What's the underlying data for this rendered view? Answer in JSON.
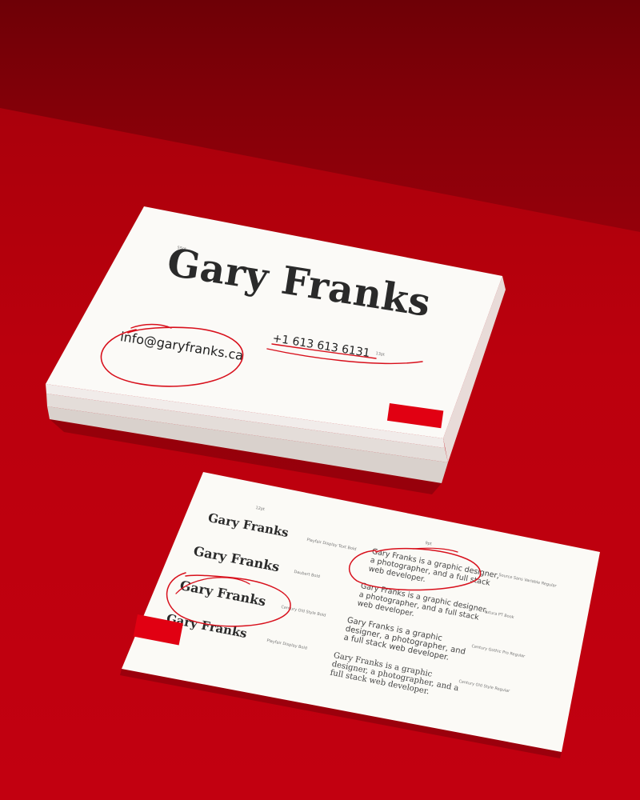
{
  "card_front": {
    "name": "Gary Franks",
    "email": "info@garyfranks.ca",
    "phone": "+1 613 613 6131",
    "annotation_name": "55pt",
    "annotation_phone": "13pt"
  },
  "card_specimen": {
    "title_annotation": "12pt",
    "para_annotation": "9pt",
    "name_samples": [
      {
        "text": "Gary Franks",
        "label": "Playfair Display Text Bold"
      },
      {
        "text": "Gary Franks",
        "label": "Daubert Bold"
      },
      {
        "text": "Gary Franks",
        "label": "Century Old Style Bold"
      },
      {
        "text": "Gary Franks",
        "label": "Playfair Display Bold"
      }
    ],
    "paragraph_samples": [
      {
        "lines": [
          "Gary Franks is a graphic designer,",
          "a photographer, and a full stack",
          "web developer."
        ],
        "label": "Source Sans Variable Regular"
      },
      {
        "lines": [
          "Gary Franks is a graphic designer,",
          "a photographer, and a full stack",
          "web developer."
        ],
        "label": "Futura PT Book"
      },
      {
        "lines": [
          "Gary Franks is a graphic",
          "designer, a photographer, and",
          "a full stack web developer."
        ],
        "label": "Century Gothic Pro Regular"
      },
      {
        "lines": [
          "Gary Franks is a graphic",
          "designer, a photographer, and a",
          "full stack web developer."
        ],
        "label": "Century Old Style Regular"
      }
    ]
  },
  "colors": {
    "accent_red": "#e10012",
    "background_red": "#b5000c",
    "card_white": "#fbfaf7"
  }
}
